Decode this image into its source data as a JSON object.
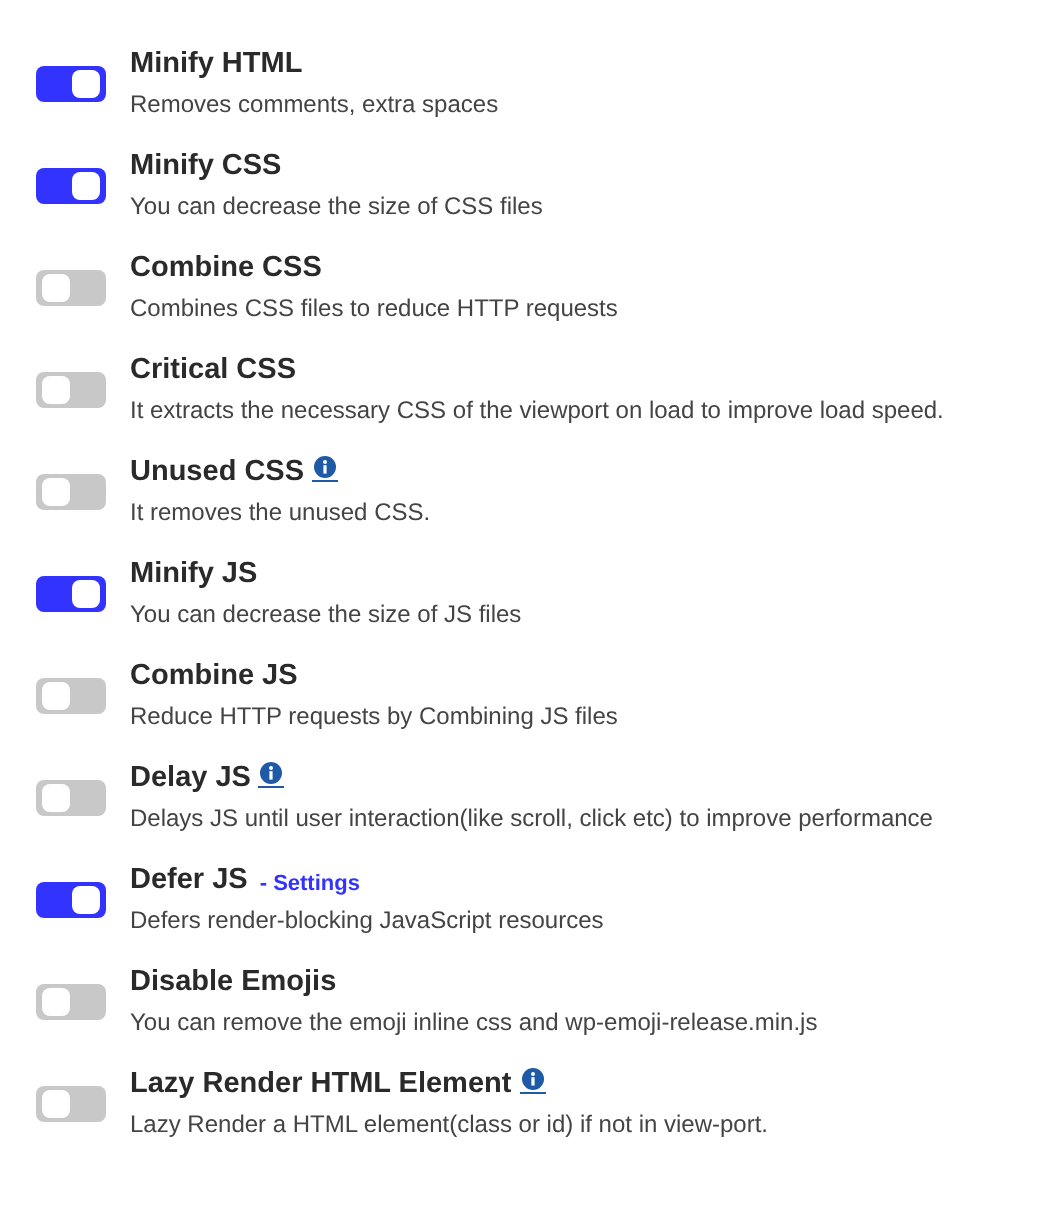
{
  "settings": [
    {
      "title": "Minify HTML",
      "description": "Removes comments, extra spaces",
      "on": true,
      "info": false
    },
    {
      "title": "Minify CSS",
      "description": "You can decrease the size of CSS files",
      "on": true,
      "info": false
    },
    {
      "title": "Combine CSS",
      "description": "Combines CSS files to reduce HTTP requests",
      "on": false,
      "info": false
    },
    {
      "title": "Critical CSS",
      "description": "It extracts the necessary CSS of the viewport on load to improve load speed.",
      "on": false,
      "info": false
    },
    {
      "title": "Unused CSS",
      "description": "It removes the unused CSS.",
      "on": false,
      "info": true
    },
    {
      "title": "Minify JS",
      "description": "You can decrease the size of JS files",
      "on": true,
      "info": false
    },
    {
      "title": "Combine JS",
      "description": "Reduce HTTP requests by Combining JS files",
      "on": false,
      "info": false
    },
    {
      "title": "Delay JS",
      "description": "Delays JS until user interaction(like scroll, click etc) to improve performance",
      "on": false,
      "info": true
    },
    {
      "title": "Defer JS",
      "link": "- Settings",
      "description": "Defers render-blocking JavaScript resources",
      "on": true,
      "info": false
    },
    {
      "title": "Disable Emojis",
      "description": "You can remove the emoji inline css and wp-emoji-release.min.js",
      "on": false,
      "info": false
    },
    {
      "title": "Lazy Render HTML Element",
      "description": "Lazy Render a HTML element(class or id) if not in view-port.",
      "on": false,
      "info": true
    }
  ]
}
